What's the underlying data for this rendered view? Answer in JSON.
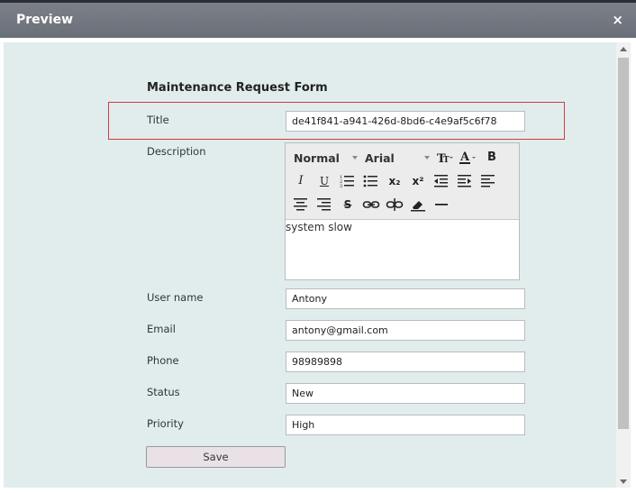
{
  "dialog": {
    "title": "Preview",
    "close_glyph": "×"
  },
  "form": {
    "heading": "Maintenance Request Form",
    "fields": {
      "title": {
        "label": "Title",
        "value": "de41f841-a941-426d-8bd6-c4e9af5c6f78"
      },
      "description": {
        "label": "Description",
        "value": "system slow"
      },
      "user_name": {
        "label": "User name",
        "value": "Antony"
      },
      "email": {
        "label": "Email",
        "value": "antony@gmail.com"
      },
      "phone": {
        "label": "Phone",
        "value": "98989898"
      },
      "status": {
        "label": "Status",
        "value": "New"
      },
      "priority": {
        "label": "Priority",
        "value": "High"
      }
    },
    "save_label": "Save"
  },
  "editor_toolbar": {
    "format_select": "Normal",
    "font_select": "Arial",
    "icons": [
      "font-size-icon",
      "font-color-icon",
      "bold-icon",
      "italic-icon",
      "underline-icon",
      "ordered-list-icon",
      "bullet-list-icon",
      "subscript-icon",
      "superscript-icon",
      "outdent-icon",
      "indent-icon",
      "align-left-icon",
      "align-center-icon",
      "align-right-icon",
      "strikethrough-icon",
      "link-icon",
      "unlink-icon",
      "clear-format-icon",
      "horizontal-rule-icon"
    ],
    "glyphs": {
      "bold": "B",
      "italic": "I",
      "underline": "U",
      "subscript": "x₂",
      "superscript": "x²",
      "strikethrough": "S",
      "font_color": "A"
    }
  },
  "colors": {
    "titlebar": "#6f747d",
    "content_bg": "#e1eded",
    "highlight_border": "#d23b3b",
    "save_bg": "#eae1e6"
  }
}
